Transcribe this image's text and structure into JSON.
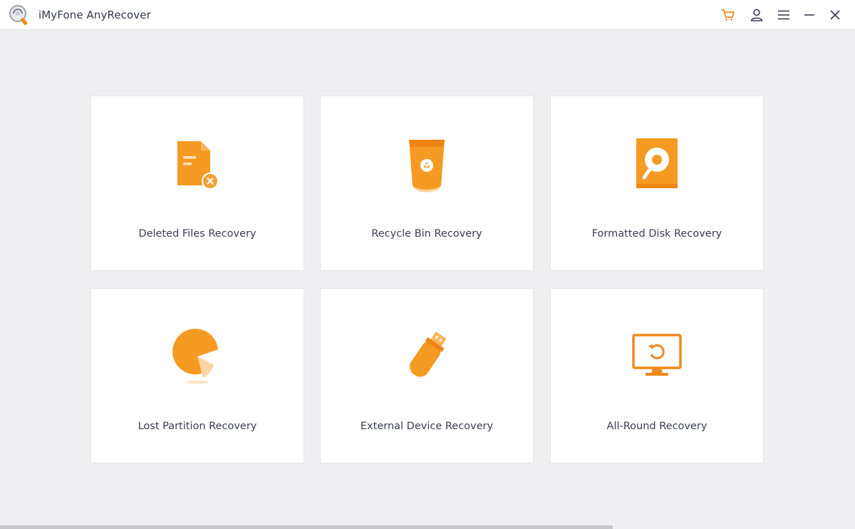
{
  "app": {
    "title": "iMyFone AnyRecover"
  },
  "toolbar": {
    "icons": [
      "cart-icon",
      "user-icon",
      "menu-icon",
      "minimize-icon",
      "close-icon"
    ]
  },
  "colors": {
    "accent": "#f59a23",
    "accent_dark": "#ee7f0e",
    "card_bg": "#ffffff",
    "window_bg": "#efeff1",
    "text": "#3a3f52"
  },
  "modes": [
    {
      "label": "Deleted Files Recovery",
      "icon": "deleted-file-icon"
    },
    {
      "label": "Recycle Bin Recovery",
      "icon": "recycle-bin-icon"
    },
    {
      "label": "Formatted Disk Recovery",
      "icon": "formatted-disk-icon"
    },
    {
      "label": "Lost Partition Recovery",
      "icon": "lost-partition-icon"
    },
    {
      "label": "External Device Recovery",
      "icon": "usb-drive-icon"
    },
    {
      "label": "All-Round Recovery",
      "icon": "monitor-refresh-icon"
    }
  ]
}
